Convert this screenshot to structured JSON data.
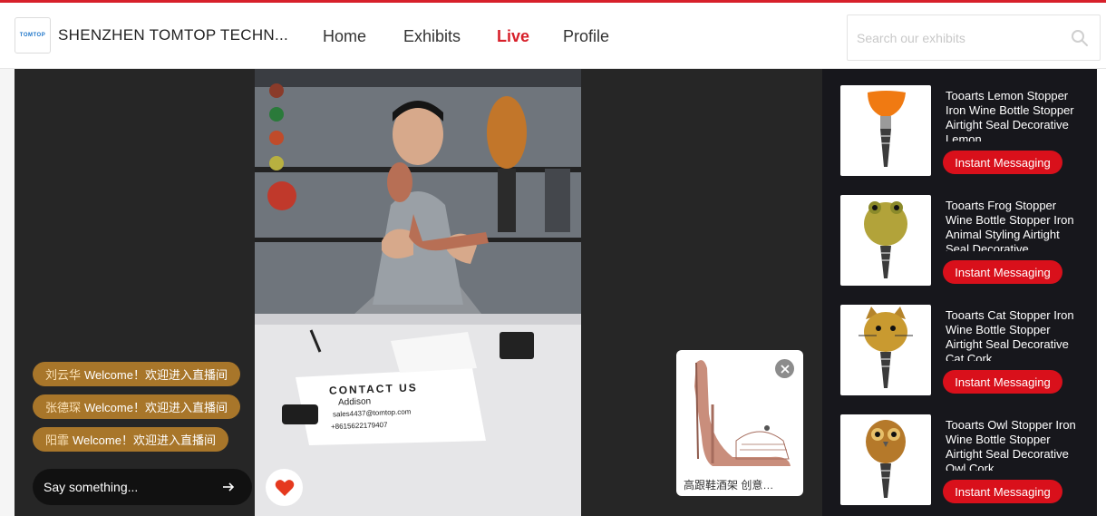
{
  "brand": {
    "logo_text": "TOMTOP",
    "company_name": "SHENZHEN TOMTOP TECHN..."
  },
  "nav": {
    "home": "Home",
    "exhibits": "Exhibits",
    "live": "Live",
    "profile": "Profile",
    "active": "Live"
  },
  "search": {
    "placeholder": "Search our exhibits"
  },
  "colors": {
    "accent": "#d7202a",
    "welcome_badge": "#a8762a",
    "panel_bg": "#17171c",
    "button_red": "#d9101b"
  },
  "video": {
    "sign_title": "CONTACT US",
    "sign_name": "Addison",
    "sign_email": "sales4437@tomtop.com",
    "sign_phone": "+8615622179407"
  },
  "chat": {
    "messages": [
      {
        "user": "刘云华",
        "text": "Welcome！欢迎进入直播间"
      },
      {
        "user": "张德琛",
        "text": "Welcome！欢迎进入直播间"
      },
      {
        "user": "阳霏",
        "text": "Welcome！欢迎进入直播间"
      }
    ],
    "input_placeholder": "Say something..."
  },
  "popup": {
    "caption": "高跟鞋酒架 创意…"
  },
  "products": [
    {
      "title": "Tooarts Lemon Stopper Iron Wine Bottle Stopper Airtight Seal Decorative Lemon",
      "button": "Instant Messaging"
    },
    {
      "title": "Tooarts Frog Stopper Wine Bottle Stopper Iron Animal Styling Airtight Seal Decorative",
      "button": "Instant Messaging"
    },
    {
      "title": "Tooarts Cat Stopper Iron Wine Bottle Stopper Airtight Seal Decorative Cat Cork",
      "button": "Instant Messaging"
    },
    {
      "title": "Tooarts Owl Stopper Iron Wine Bottle Stopper Airtight Seal Decorative Owl Cork",
      "button": "Instant Messaging"
    }
  ]
}
